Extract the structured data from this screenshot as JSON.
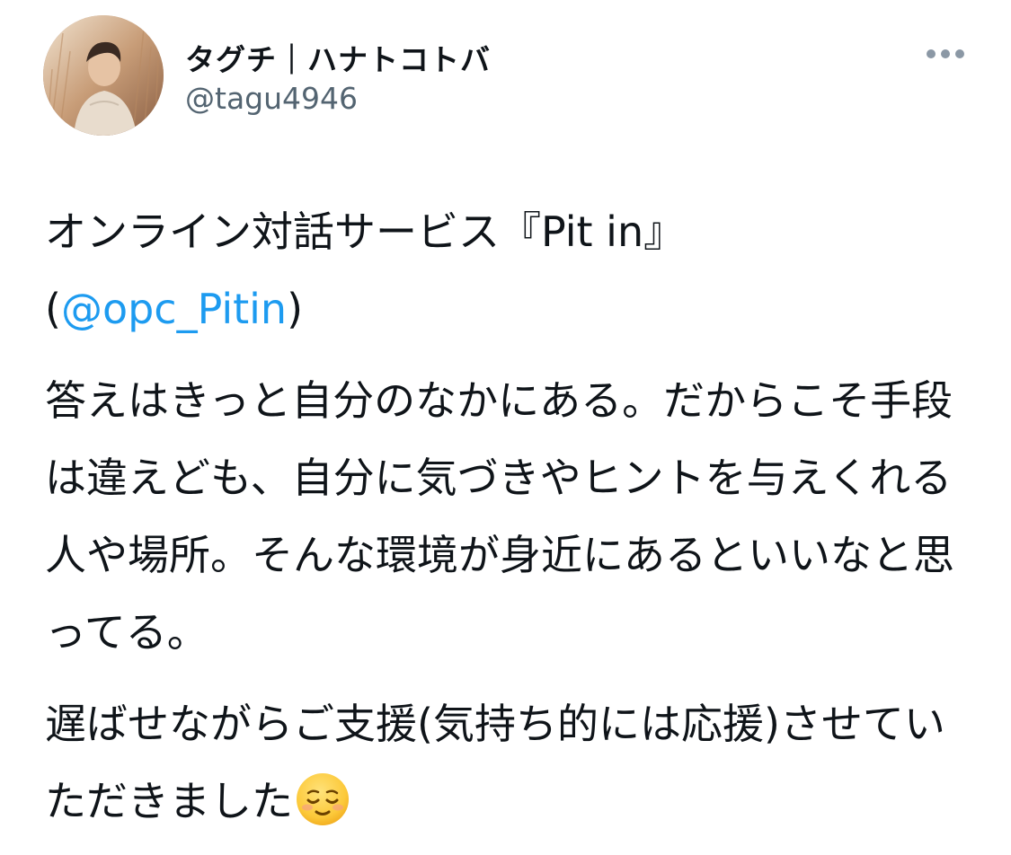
{
  "author": {
    "display_name": "タグチ｜ハナトコトバ",
    "handle": "@tagu4946",
    "avatar_icon": "avatar-photo"
  },
  "actions": {
    "more_icon": "more-dots-icon"
  },
  "tweet": {
    "p1_text": "オンライン対話サービス『Pit in』",
    "p1_open": "(",
    "p1_mention": "@opc_Pitin",
    "p1_close": ")",
    "p2_text": "答えはきっと自分のなかにある。だからこそ手段は違えども、自分に気づきやヒントを与えくれる人や場所。そんな環境が身近にあるといいなと思ってる。",
    "p3_text": "遅ばせながらご支援(気持ち的には応援)させていただきました",
    "p3_emoji": "relieved-face-emoji"
  },
  "colors": {
    "mention": "#1d9bf0",
    "text": "#0f1419",
    "secondary": "#536471"
  }
}
